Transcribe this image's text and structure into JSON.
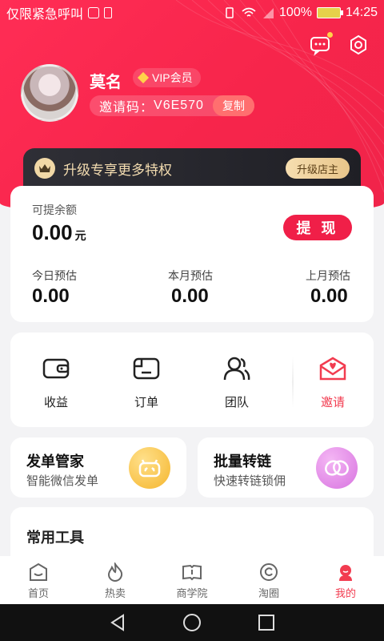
{
  "status_bar": {
    "carrier": "仅限紧急呼叫",
    "battery": "100%",
    "time": "14:25"
  },
  "profile": {
    "name": "莫名",
    "vip_label": "VIP会员",
    "invite_label": "邀请码：",
    "invite_code": "V6E570",
    "copy_label": "复制"
  },
  "upgrade": {
    "text": "升级专享更多特权",
    "button": "升级店主"
  },
  "balance": {
    "title": "可提余额",
    "value": "0.00",
    "unit": "元",
    "withdraw_label": "提 现",
    "estimates": [
      {
        "label": "今日预估",
        "value": "0.00"
      },
      {
        "label": "本月预估",
        "value": "0.00"
      },
      {
        "label": "上月预估",
        "value": "0.00"
      }
    ]
  },
  "quick_menu": [
    {
      "label": "收益",
      "icon": "wallet-icon"
    },
    {
      "label": "订单",
      "icon": "order-icon"
    },
    {
      "label": "团队",
      "icon": "team-icon"
    },
    {
      "label": "邀请",
      "icon": "invite-icon"
    }
  ],
  "features": [
    {
      "title": "发单管家",
      "subtitle": "智能微信发单",
      "icon": "robot-icon",
      "color": "#f9c748"
    },
    {
      "title": "批量转链",
      "subtitle": "快速转链锁佣",
      "icon": "link-icon",
      "color": "#e58bea"
    }
  ],
  "tools": {
    "title": "常用工具"
  },
  "tabs": [
    {
      "label": "首页",
      "icon": "home-icon"
    },
    {
      "label": "热卖",
      "icon": "fire-icon"
    },
    {
      "label": "商学院",
      "icon": "book-icon"
    },
    {
      "label": "淘圈",
      "icon": "circle-icon"
    },
    {
      "label": "我的",
      "icon": "profile-icon"
    }
  ],
  "colors": {
    "accent": "#f01f48",
    "active_tab": "#f23c50"
  }
}
